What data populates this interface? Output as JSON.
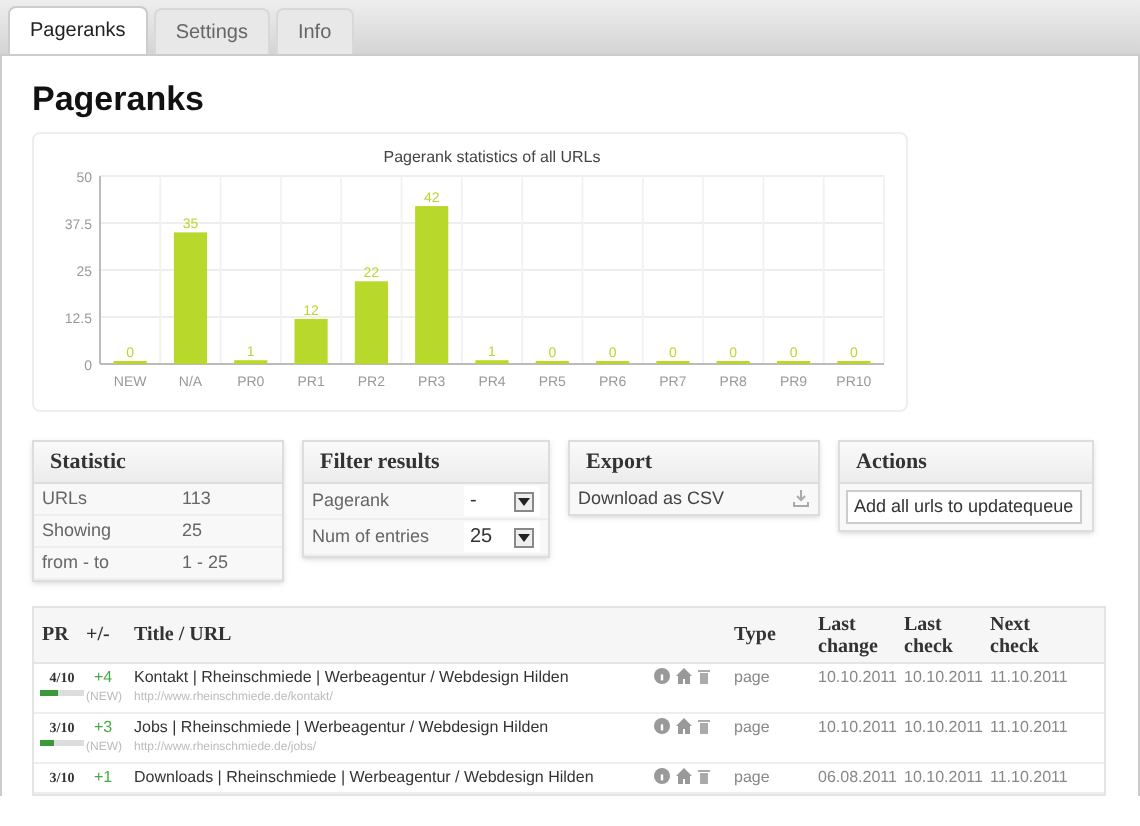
{
  "tabs": [
    {
      "label": "Pageranks",
      "selected": true
    },
    {
      "label": "Settings",
      "selected": false
    },
    {
      "label": "Info",
      "selected": false
    }
  ],
  "heading": "Pageranks",
  "chart_data": {
    "type": "bar",
    "title": "Pagerank statistics of all URLs",
    "categories": [
      "NEW",
      "N/A",
      "PR0",
      "PR1",
      "PR2",
      "PR3",
      "PR4",
      "PR5",
      "PR6",
      "PR7",
      "PR8",
      "PR9",
      "PR10"
    ],
    "series": [
      {
        "color": "#b8d82c",
        "values": [
          0,
          35,
          1,
          12,
          22,
          42,
          1,
          0,
          0,
          0,
          0,
          0,
          0
        ]
      }
    ],
    "ylim": [
      0,
      50
    ],
    "yticks": [
      0,
      12.5,
      25,
      37.5,
      50
    ],
    "data_labels": true,
    "grid": true
  },
  "statistic": {
    "title": "Statistic",
    "rows": [
      {
        "label": "URLs",
        "value": "113"
      },
      {
        "label": "Showing",
        "value": "25"
      },
      {
        "label": "from - to",
        "value": "1 - 25"
      }
    ]
  },
  "filter": {
    "title": "Filter results",
    "fields": [
      {
        "label": "Pagerank",
        "value": "-"
      },
      {
        "label": "Num of entries",
        "value": "25"
      }
    ]
  },
  "export": {
    "title": "Export",
    "link": "Download as CSV"
  },
  "actions": {
    "title": "Actions",
    "button": "Add all urls to updatequeue"
  },
  "table": {
    "columns": [
      "PR",
      "+/-",
      "Title / URL",
      "",
      "Type",
      "Last change",
      "Last check",
      "Next check"
    ],
    "rows": [
      {
        "pr": "4/10",
        "level": 0.4,
        "change": "+4",
        "badge": "(NEW)",
        "title": "Kontakt | Rheinschmiede | Werbeagentur / Webdesign Hilden",
        "url": "http://www.rheinschmiede.de/kontakt/",
        "type": "page",
        "last_change": "10.10.2011",
        "last_check": "10.10.2011",
        "next_check": "11.10.2011"
      },
      {
        "pr": "3/10",
        "level": 0.3,
        "change": "+3",
        "badge": "(NEW)",
        "title": "Jobs | Rheinschmiede | Werbeagentur / Webdesign Hilden",
        "url": "http://www.rheinschmiede.de/jobs/",
        "type": "page",
        "last_change": "10.10.2011",
        "last_check": "10.10.2011",
        "next_check": "11.10.2011"
      },
      {
        "pr": "3/10",
        "change": "+1",
        "title": "Downloads | Rheinschmiede | Werbeagentur / Webdesign Hilden",
        "type": "page",
        "last_change": "06.08.2011",
        "last_check": "10.10.2011",
        "next_check": "11.10.2011"
      }
    ]
  }
}
